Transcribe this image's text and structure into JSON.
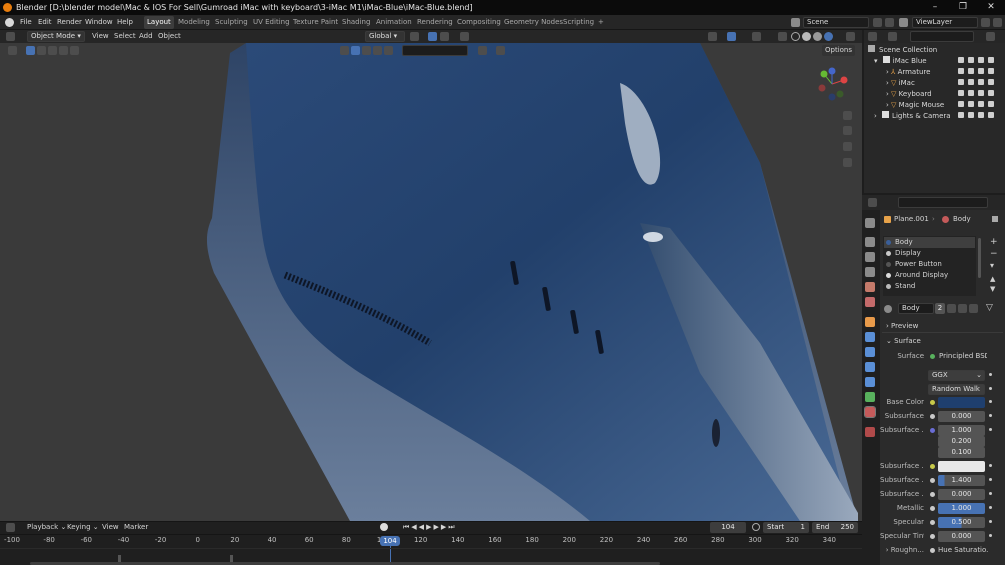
{
  "titlebar": {
    "title": "Blender [D:\\blender model\\Mac & IOS For Sell\\Gumroad iMac with keyboard\\3-iMac M1\\iMac-Blue\\iMac-Blue.blend]",
    "min": "–",
    "max": "❐",
    "close": "✕"
  },
  "menu": [
    "File",
    "Edit",
    "Render",
    "Window",
    "Help"
  ],
  "workspaces": [
    "Layout",
    "Modeling",
    "Sculpting",
    "UV Editing",
    "Texture Paint",
    "Shading",
    "Animation",
    "Rendering",
    "Compositing",
    "Geometry Nodes",
    "Scripting"
  ],
  "add_workspace": "+",
  "scene": {
    "name": "Scene",
    "view_layer": "ViewLayer"
  },
  "viewport_header": {
    "mode": "Object Mode",
    "view": "View",
    "select": "Select",
    "add": "Add",
    "object": "Object",
    "orientation": "Global",
    "options": "Options"
  },
  "outliner": {
    "root": "Scene Collection",
    "items": [
      {
        "label": "iMac Blue",
        "indent": 0,
        "icon": "collection-icon",
        "expanded": "▾"
      },
      {
        "label": "Armature",
        "indent": 1,
        "icon": "armature-icon",
        "expanded": "›"
      },
      {
        "label": "iMac",
        "indent": 1,
        "icon": "mesh-icon",
        "expanded": "›"
      },
      {
        "label": "Keyboard",
        "indent": 1,
        "icon": "mesh-icon",
        "expanded": "›"
      },
      {
        "label": "Magic Mouse",
        "indent": 1,
        "icon": "mesh-icon",
        "expanded": "›"
      },
      {
        "label": "Lights & Camera",
        "indent": 0,
        "icon": "collection-icon",
        "expanded": "›"
      }
    ]
  },
  "properties": {
    "breadcrumb_object": "Plane.001",
    "breadcrumb_material": "Body",
    "materials": [
      "Body",
      "Display",
      "Power Button",
      "Around Display",
      "Stand"
    ],
    "material_name": "Body",
    "material_users": "2",
    "preview_label": "Preview",
    "surface_panel": "Surface",
    "surface_label": "Surface",
    "surface_value": "Principled BSDF",
    "distribution": "GGX",
    "subsurface_method": "Random Walk",
    "rows": [
      {
        "label": "Base Color",
        "value": "",
        "kind": "color",
        "color": "#1f3f6e"
      },
      {
        "label": "Subsurface",
        "value": "0.000",
        "kind": "num"
      },
      {
        "label": "Subsurface ...",
        "value": "1.000",
        "kind": "num"
      },
      {
        "label": "",
        "value": "0.200",
        "kind": "num"
      },
      {
        "label": "",
        "value": "0.100",
        "kind": "num"
      },
      {
        "label": "Subsurface ...",
        "value": "",
        "kind": "color",
        "color": "#e8e8e8"
      },
      {
        "label": "Subsurface ...",
        "value": "1.400",
        "kind": "num"
      },
      {
        "label": "Subsurface ...",
        "value": "0.000",
        "kind": "num"
      },
      {
        "label": "Metallic",
        "value": "1.000",
        "kind": "blue"
      },
      {
        "label": "Specular",
        "value": "0.500",
        "kind": "num"
      },
      {
        "label": "Specular Tint",
        "value": "0.000",
        "kind": "num"
      },
      {
        "label": "Roughn...",
        "value": "Hue Saturatio...",
        "kind": "link"
      }
    ]
  },
  "timeline": {
    "playback": "Playback",
    "keying": "Keying",
    "view": "View",
    "marker": "Marker",
    "current_frame": "104",
    "start_label": "Start",
    "start": "1",
    "end_label": "End",
    "end": "250",
    "ticks": [
      "-100",
      "-80",
      "-60",
      "-40",
      "-20",
      "0",
      "20",
      "40",
      "60",
      "80",
      "100",
      "120",
      "140",
      "160",
      "180",
      "200",
      "220",
      "240",
      "260",
      "280",
      "300",
      "320",
      "340"
    ]
  },
  "colors": {
    "accent": "#4772b3",
    "imac_blue": "#23406a",
    "orange": "#e87d0d"
  }
}
